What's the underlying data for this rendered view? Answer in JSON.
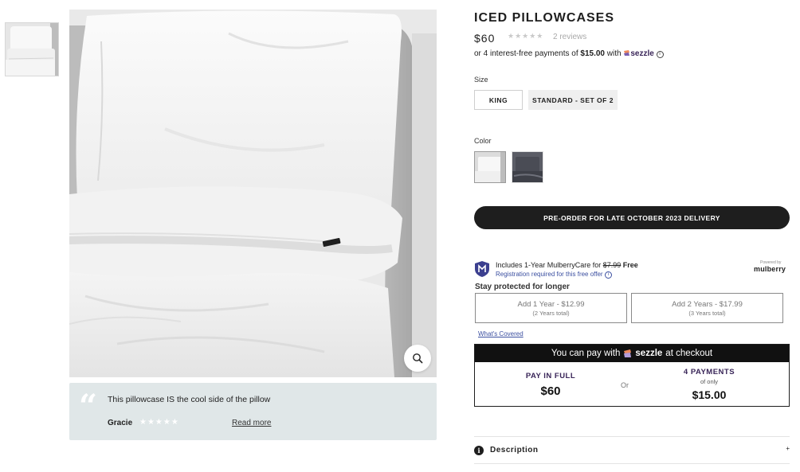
{
  "product": {
    "title": "ICED PILLOWCASES",
    "price": "$60",
    "rating_stars": "★★★★★",
    "reviews_label": "2 reviews",
    "installments_prefix": "or 4 interest-free payments of ",
    "installments_amount": "$15.00",
    "installments_with": " with ",
    "installments_brand": "sezzle"
  },
  "options": {
    "size_label": "Size",
    "sizes": [
      "KING",
      "STANDARD - SET OF 2"
    ],
    "color_label": "Color",
    "colors": [
      "white",
      "dark grey"
    ]
  },
  "preorder_button": "PRE-ORDER FOR LATE OCTOBER 2023 DELIVERY",
  "mulberry": {
    "line1_prefix": "Includes 1-Year MulberryCare for ",
    "line1_old_price": "$7.99",
    "line1_free": " Free",
    "line2": "Registration required for this free offer",
    "powered_by": "Powered by",
    "brand": "mulberry",
    "stay_protected": "Stay protected for longer",
    "plans": [
      {
        "main": "Add 1 Year - $12.99",
        "sub": "(2 Years total)"
      },
      {
        "main": "Add 2 Years - $17.99",
        "sub": "(3 Years total)"
      }
    ],
    "whats_covered": "What's Covered"
  },
  "sezzle_box": {
    "head_prefix": "You can pay with",
    "head_brand": "sezzle",
    "head_suffix": "at checkout",
    "pay_full_label": "PAY IN FULL",
    "pay_full_value": "$60",
    "or": "Or",
    "payments_label": "4 PAYMENTS",
    "payments_sub": "of only",
    "payments_value": "$15.00"
  },
  "review": {
    "text": "This pillowcase IS the cool side of the pillow",
    "author": "Gracie",
    "stars": "★★★★★",
    "read_more": "Read more"
  },
  "description": {
    "label": "Description",
    "toggle": "+"
  },
  "colors": {
    "dark": "#1e1e1e",
    "sezzle_purple": "#392558",
    "mulberry_blue": "#3b4fa0",
    "review_bg": "#e0e7e8"
  }
}
